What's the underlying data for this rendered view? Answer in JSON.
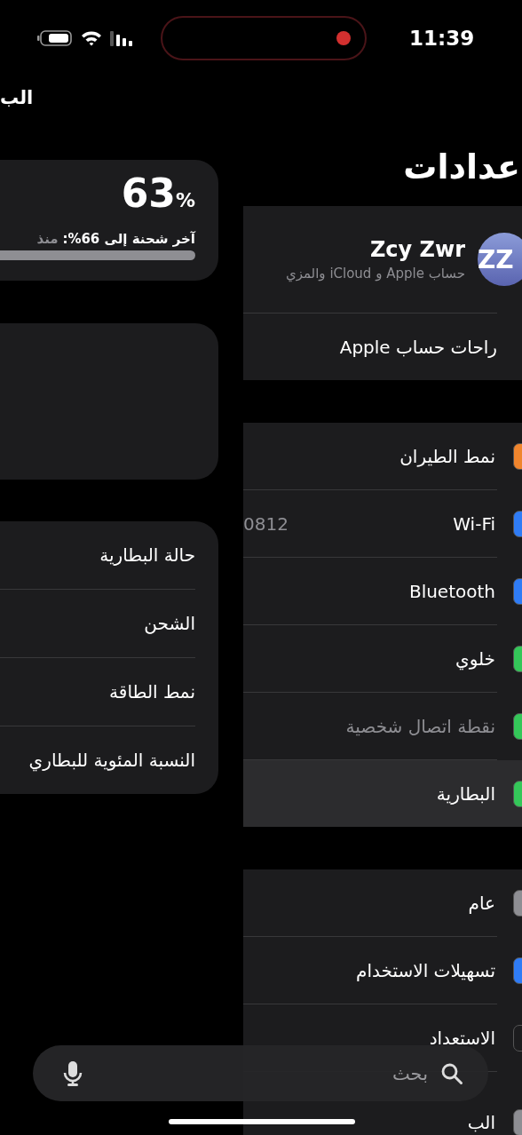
{
  "status_bar": {
    "time": "11:39",
    "recording": true
  },
  "battery_screen": {
    "title": "الب",
    "percent": "63",
    "percent_sign": "%",
    "last_charge": "آخر شحنة إلى 66%:",
    "since": "منذ",
    "options": [
      {
        "label": "حالة البطارية"
      },
      {
        "label": "الشحن"
      },
      {
        "label": "نمط الطاقة"
      },
      {
        "label": "النسبة المئوية للبطاري"
      }
    ]
  },
  "settings_screen": {
    "title": "عدادات",
    "account": {
      "initials": "ZZ",
      "name": "Zcy Zwr",
      "subtitle": "حساب Apple و iCloud والمزي",
      "suggestion": "راحات حساب Apple"
    },
    "groups": [
      [
        {
          "label": "نمط الطيران",
          "color": "#f0852d",
          "selected": false,
          "disabled": false
        },
        {
          "label": "Wi-Fi",
          "value": "0812",
          "color": "#2f7cf6",
          "selected": false,
          "disabled": false
        },
        {
          "label": "Bluetooth",
          "color": "#2f7cf6",
          "selected": false,
          "disabled": false
        },
        {
          "label": "خلوي",
          "color": "#34c759",
          "selected": false,
          "disabled": false
        },
        {
          "label": "نقطة اتصال شخصية",
          "color": "#34c759",
          "selected": false,
          "disabled": true
        },
        {
          "label": "البطارية",
          "color": "#34c759",
          "selected": true,
          "disabled": false
        }
      ],
      [
        {
          "label": "عام",
          "color": "#8e8e93",
          "selected": false,
          "disabled": false
        },
        {
          "label": "تسهيلات الاستخدام",
          "color": "#2f7cf6",
          "selected": false,
          "disabled": false
        },
        {
          "label": "الاستعداد",
          "color": "#1c1c1e",
          "selected": false,
          "disabled": false
        },
        {
          "label": "الب",
          "color": "#8e8e93",
          "selected": false,
          "disabled": false
        }
      ]
    ]
  },
  "search": {
    "placeholder": "بحث"
  }
}
